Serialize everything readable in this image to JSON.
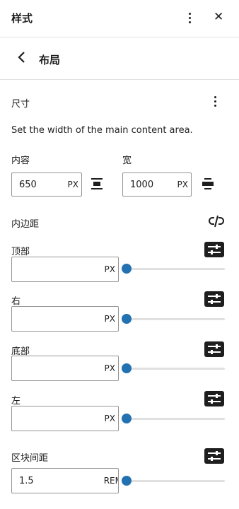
{
  "header": {
    "title": "样式",
    "close_glyph": "✕"
  },
  "subheader": {
    "title": "布局",
    "back_glyph": "‹"
  },
  "dimensions": {
    "title": "尺寸",
    "description": "Set the width of the main content area.",
    "content": {
      "label": "内容",
      "value": "650",
      "unit": "PX"
    },
    "wide": {
      "label": "宽",
      "value": "1000",
      "unit": "PX"
    }
  },
  "padding": {
    "label": "内边距",
    "sides": [
      {
        "label": "顶部",
        "value": "",
        "unit": "PX",
        "slider": 0
      },
      {
        "label": "右",
        "value": "",
        "unit": "PX",
        "slider": 0
      },
      {
        "label": "底部",
        "value": "",
        "unit": "PX",
        "slider": 0
      },
      {
        "label": "左",
        "value": "",
        "unit": "PX",
        "slider": 0
      }
    ]
  },
  "block_spacing": {
    "label": "区块间距",
    "value": "1.5",
    "unit": "REM",
    "slider": 0
  },
  "icons": {
    "back": "chevron-left-icon",
    "more": "more-vertical-icon",
    "close": "close-icon",
    "justify": "justify-center-icon",
    "stretch": "justify-stretch-icon",
    "unlink": "unlink-icon",
    "custom": "settings-icon"
  },
  "colors": {
    "accent": "#2271b1",
    "border": "#949494",
    "divider": "#e0e0e0",
    "text": "#1e1e1e"
  }
}
